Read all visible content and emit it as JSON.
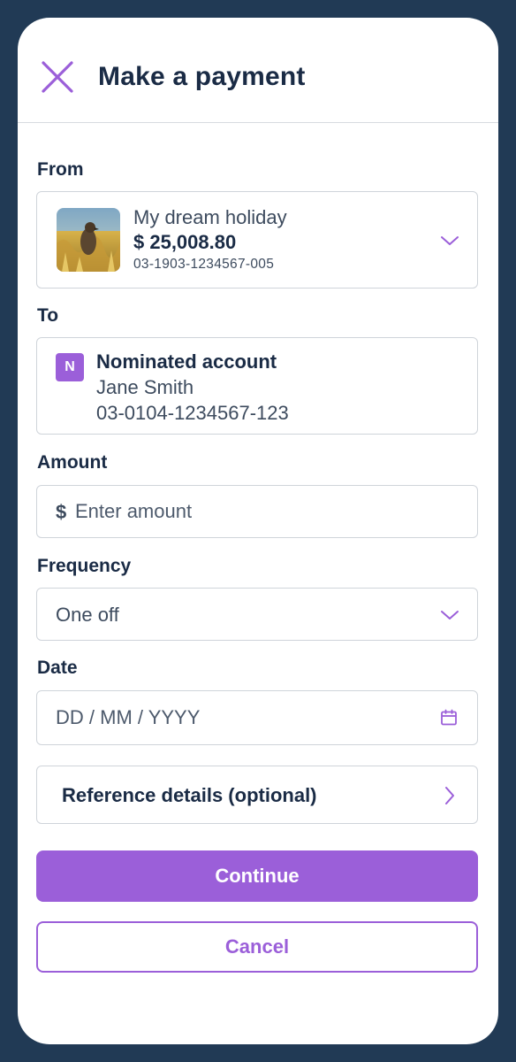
{
  "header": {
    "title": "Make a payment",
    "close_icon": "close-icon"
  },
  "from": {
    "label": "From",
    "account_name": "My dream holiday",
    "balance": "$ 25,008.80",
    "account_number": "03-1903-1234567-005",
    "icon": "chevron-down-icon"
  },
  "to": {
    "label": "To",
    "badge": "N",
    "title": "Nominated account",
    "name": "Jane Smith",
    "account_number": "03-0104-1234567-123"
  },
  "amount": {
    "label": "Amount",
    "currency_symbol": "$",
    "placeholder": "Enter amount",
    "value": ""
  },
  "frequency": {
    "label": "Frequency",
    "value": "One off",
    "icon": "chevron-down-icon"
  },
  "date": {
    "label": "Date",
    "placeholder": "DD / MM / YYYY",
    "value": "",
    "icon": "calendar-icon"
  },
  "reference": {
    "label": "Reference details (optional)",
    "icon": "chevron-right-icon"
  },
  "actions": {
    "continue": "Continue",
    "cancel": "Cancel"
  },
  "colors": {
    "accent": "#9b5fd9",
    "text": "#1a2b45",
    "frame": "#213a55",
    "border": "#cfd4da"
  }
}
